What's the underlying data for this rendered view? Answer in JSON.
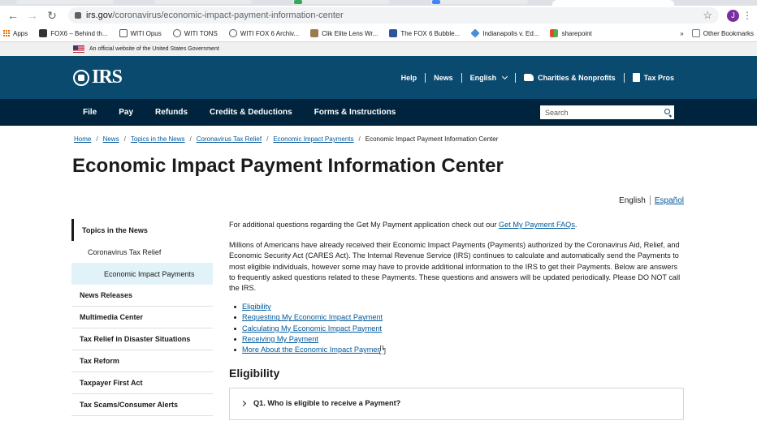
{
  "browser": {
    "url_host": "irs.gov",
    "url_path": "/coronavirus/economic-impact-payment-information-center",
    "profile_initial": "J",
    "bookmarks": [
      {
        "label": "Apps",
        "color": "#e8710a"
      },
      {
        "label": "FOX6 – Behind th...",
        "color": "#333333"
      },
      {
        "label": "WITI Opus",
        "color": "#555555"
      },
      {
        "label": "WITI TONS",
        "color": "#555555"
      },
      {
        "label": "WITI FOX 6 Archiv...",
        "color": "#555555"
      },
      {
        "label": "Clik Elite Lens Wr...",
        "color": "#9a7b4f"
      },
      {
        "label": "The FOX 6 Bubble...",
        "color": "#2b579a"
      },
      {
        "label": "Indianapolis v. Ed...",
        "color": "#4a8fd6"
      },
      {
        "label": "sharepoint",
        "color": "#e34c26"
      }
    ],
    "other_bookmarks": "Other Bookmarks",
    "overflow": "»"
  },
  "gov_banner": {
    "text": "An official website of the United States Government"
  },
  "header": {
    "logo": "IRS",
    "utility": {
      "help": "Help",
      "news": "News",
      "language": "English",
      "charities": "Charities & Nonprofits",
      "tax_pros": "Tax Pros"
    },
    "main_nav": [
      "File",
      "Pay",
      "Refunds",
      "Credits & Deductions",
      "Forms & Instructions"
    ],
    "search_placeholder": "Search"
  },
  "breadcrumb": {
    "links": [
      "Home",
      "News",
      "Topics in the News",
      "Coronavirus Tax Relief",
      "Economic Impact Payments"
    ],
    "current": "Economic Impact Payment Information Center"
  },
  "page": {
    "title": "Economic Impact Payment Information Center",
    "lang_current": "English",
    "lang_alt": "Español"
  },
  "sidebar": {
    "topic": "Topics in the News",
    "sub": "Coronavirus Tax Relief",
    "subsub": "Economic Impact Payments",
    "items": [
      "News Releases",
      "Multimedia Center",
      "Tax Relief in Disaster Situations",
      "Tax Reform",
      "Taxpayer First Act",
      "Tax Scams/Consumer Alerts"
    ]
  },
  "content": {
    "intro_prefix": "For additional questions regarding the Get My Payment application check out our ",
    "intro_link": "Get My Payment FAQs",
    "intro_suffix": ".",
    "body": "Millions of Americans have already received their Economic Impact Payments (Payments) authorized by the Coronavirus Aid, Relief, and Economic Security Act (CARES Act). The Internal Revenue Service (IRS) continues to calculate and automatically send the Payments to most eligible individuals, however some may have to provide additional information to the IRS to get their Payments. Below are answers to frequently asked questions related to these Payments. These questions and answers will be updated periodically. Please DO NOT call the IRS.",
    "toc": [
      "Eligibility",
      "Requesting My Economic Impact Payment",
      "Calculating My Economic Impact Payment",
      "Receiving My Payment",
      "More About the Economic Impact Payment"
    ],
    "section_heading": "Eligibility",
    "q1": "Q1.  Who is eligible to receive a Payment?"
  }
}
